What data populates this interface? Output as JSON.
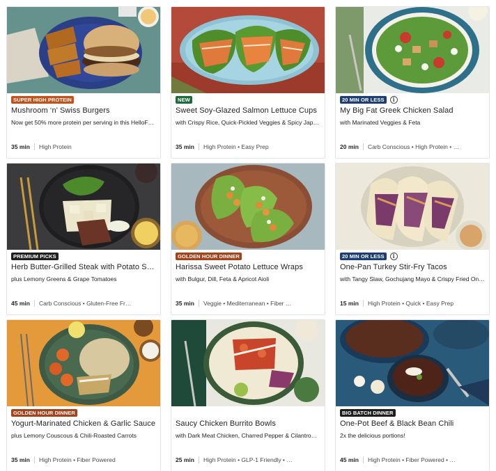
{
  "colors": {
    "badge_orange": "#c4511a",
    "badge_green": "#1f6a3a",
    "badge_navy": "#1d3e74",
    "badge_black": "#1e1e1e",
    "badge_brown": "#a5421a",
    "info_gray": "#4a4a4a"
  },
  "recipes": [
    {
      "badge": "SUPER HIGH PROTEIN",
      "badge_color": "#c4511a",
      "show_info": false,
      "title": "Mushroom ‘n’ Swiss Burgers",
      "subtitle": "Now get 50% more protein per serving in this HelloF…",
      "time": "35 min",
      "tags": "High Protein",
      "photo": "burger-photo"
    },
    {
      "badge": "NEW",
      "badge_color": "#1f6a3a",
      "show_info": false,
      "title": "Sweet Soy-Glazed Salmon Lettuce Cups",
      "subtitle": "with Crispy Rice, Quick-Pickled Veggies & Spicy Jap…",
      "time": "35 min",
      "tags": "High Protein • Easy Prep",
      "photo": "salmon-lettuce-photo"
    },
    {
      "badge": "20 MIN OR LESS",
      "badge_color": "#1d3e74",
      "show_info": true,
      "title": "My Big Fat Greek Chicken Salad",
      "subtitle": "with Marinated Veggies & Feta",
      "time": "20 min",
      "tags": "Carb Conscious • High Protein • …",
      "photo": "greek-salad-photo"
    },
    {
      "badge": "PREMIUM PICKS",
      "badge_color": "#1e1e1e",
      "show_info": false,
      "title": "Herb Butter-Grilled Steak with Potato S…",
      "subtitle": "plus Lemony Greens & Grape Tomatoes",
      "time": "45 min",
      "tags": "Carb Conscious • Gluten-Free Fr…",
      "photo": "steak-photo"
    },
    {
      "badge": "GOLDEN HOUR DINNER",
      "badge_color": "#a5421a",
      "show_info": false,
      "title": "Harissa Sweet Potato Lettuce Wraps",
      "subtitle": "with Bulgur, Dill, Feta & Apricot Aioli",
      "time": "35 min",
      "tags": "Veggie • Mediterranean • Fiber …",
      "photo": "lettuce-wraps-photo"
    },
    {
      "badge": "20 MIN OR LESS",
      "badge_color": "#1d3e74",
      "show_info": true,
      "title": "One-Pan Turkey Stir-Fry Tacos",
      "subtitle": "with Tangy Slaw, Gochujang Mayo & Crispy Fried On…",
      "time": "15 min",
      "tags": "High Protein • Quick • Easy Prep",
      "photo": "tacos-photo"
    },
    {
      "badge": "GOLDEN HOUR DINNER",
      "badge_color": "#a5421a",
      "show_info": false,
      "title": "Yogurt-Marinated Chicken & Garlic Sauce",
      "subtitle": "plus Lemony Couscous & Chili-Roasted Carrots",
      "time": "35 min",
      "tags": "High Protein • Fiber Powered",
      "photo": "yogurt-chicken-photo"
    },
    {
      "badge": "",
      "badge_color": "",
      "show_info": false,
      "title": "Saucy Chicken Burrito Bowls",
      "subtitle": "with Dark Meat Chicken, Charred Pepper & Cilantro…",
      "time": "25 min",
      "tags": "High Protein • GLP-1 Friendly • …",
      "photo": "burrito-bowl-photo"
    },
    {
      "badge": "BIG BATCH DINNER",
      "badge_color": "#1e1e1e",
      "show_info": false,
      "title": "One-Pot Beef & Black Bean Chili",
      "subtitle": "2x the delicious portions!",
      "time": "45 min",
      "tags": "High Protein • Fiber Powered • …",
      "photo": "chili-photo"
    }
  ]
}
